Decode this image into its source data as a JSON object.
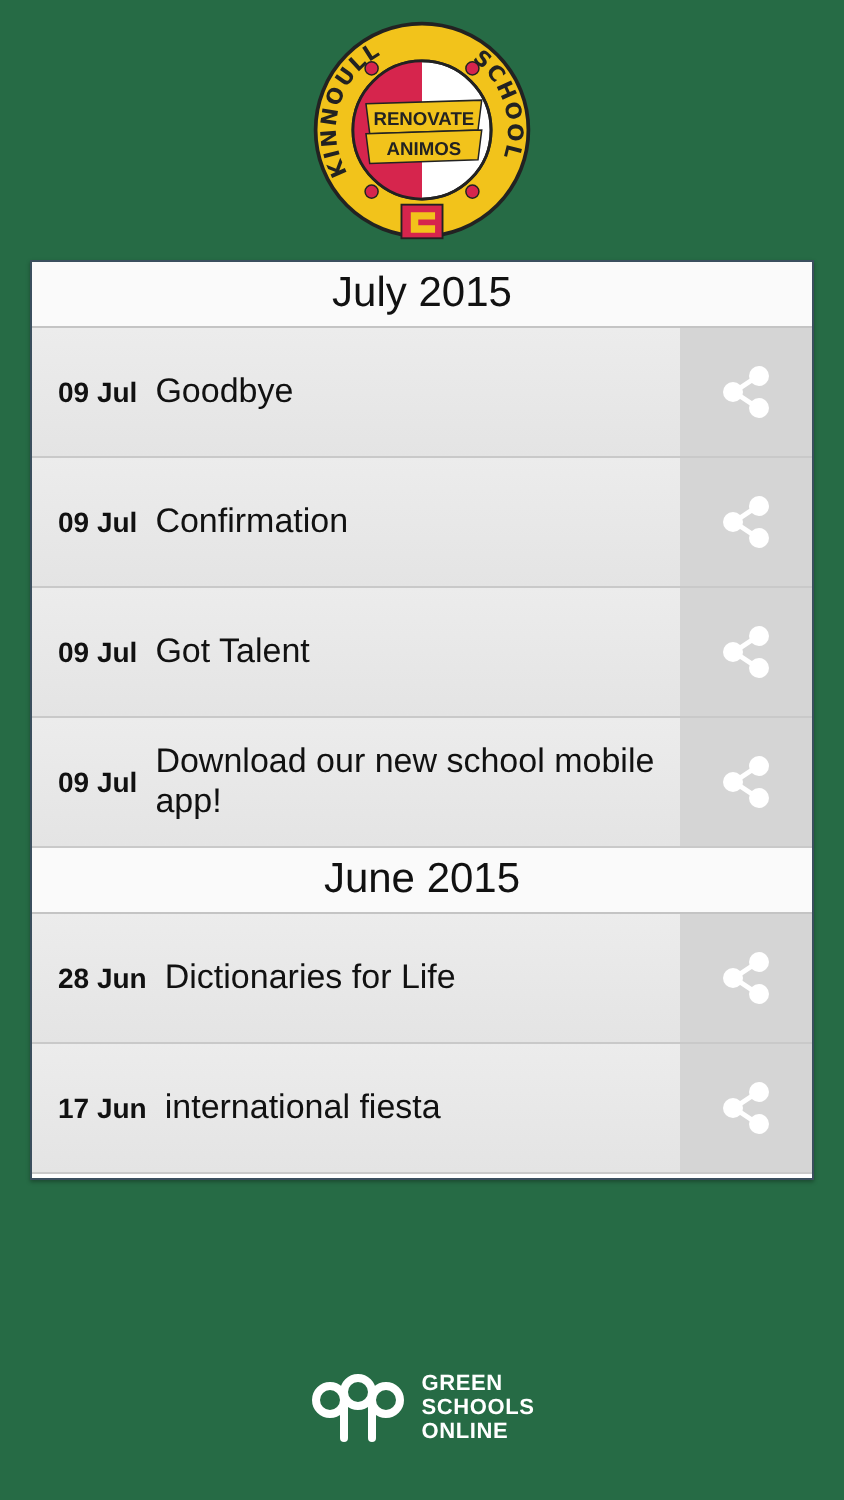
{
  "logo": {
    "left_text": "KINNOULL",
    "right_text": "SCHOOL",
    "banner": [
      "RENOVATE",
      "ANIMOS"
    ]
  },
  "sections": [
    {
      "title": "July 2015",
      "items": [
        {
          "date": "09 Jul",
          "title": "Goodbye"
        },
        {
          "date": "09 Jul",
          "title": "Confirmation"
        },
        {
          "date": "09 Jul",
          "title": "Got Talent"
        },
        {
          "date": "09 Jul",
          "title": "Download our new school mobile app!"
        }
      ]
    },
    {
      "title": "June 2015",
      "items": [
        {
          "date": "28 Jun",
          "title": "Dictionaries for Life"
        },
        {
          "date": "17 Jun",
          "title": "international fiesta"
        }
      ]
    }
  ],
  "footer": {
    "brand": [
      "GREEN",
      "SCHOOLS",
      "ONLINE"
    ]
  }
}
